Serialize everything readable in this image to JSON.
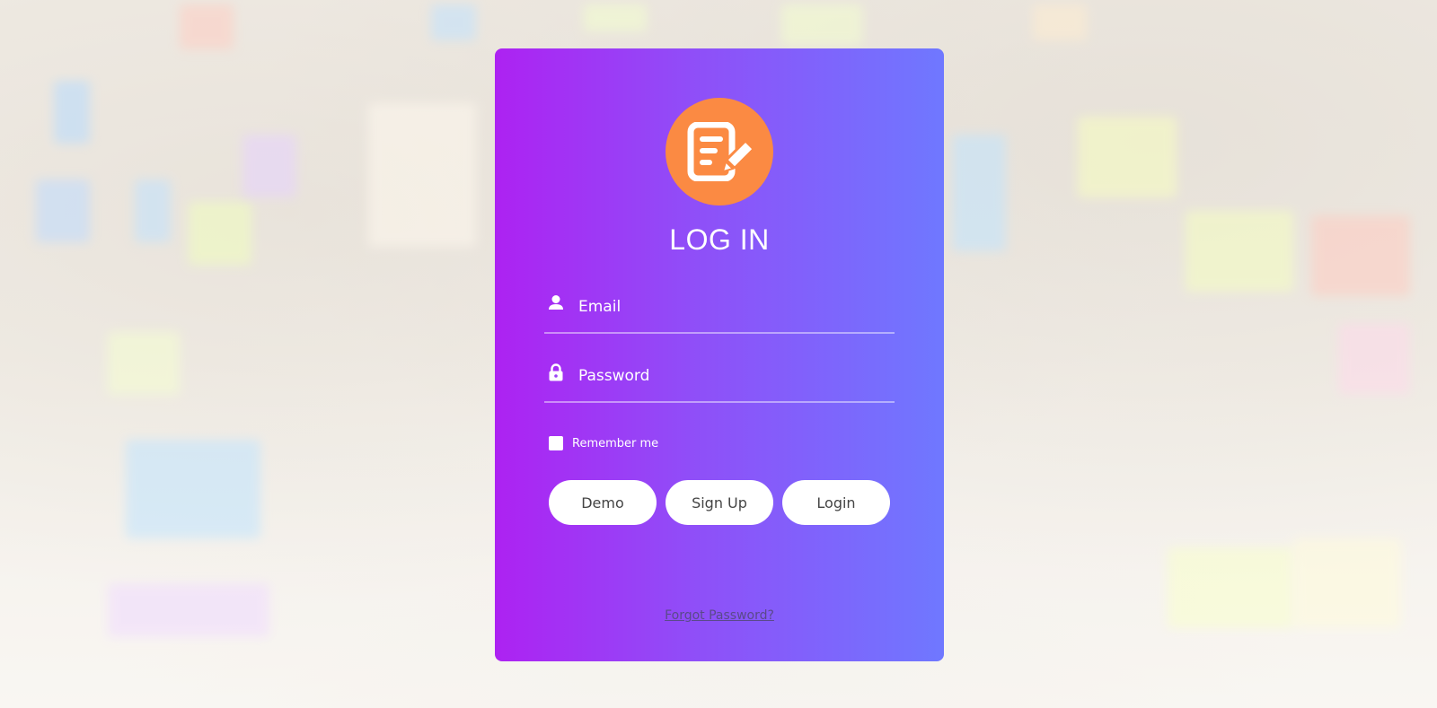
{
  "login": {
    "title": "LOG IN",
    "email_placeholder": "Email",
    "password_placeholder": "Password",
    "remember_label": "Remember me",
    "buttons": {
      "demo": "Demo",
      "signup": "Sign Up",
      "login": "Login"
    },
    "forgot_link": "Forgot Password?"
  },
  "colors": {
    "card_gradient_start": "#ad22f2",
    "card_gradient_end": "#6f78ff",
    "logo_circle": "#fb8a43",
    "button_bg": "#ffffff",
    "button_text": "#444444"
  },
  "icons": {
    "logo": "document-edit-icon",
    "email": "user-icon",
    "password": "lock-icon"
  }
}
